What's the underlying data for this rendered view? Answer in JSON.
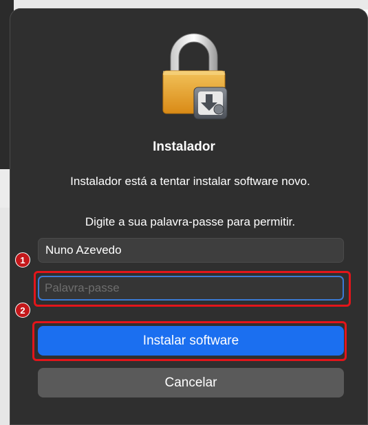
{
  "dialog": {
    "title": "Instalador",
    "message": "Instalador está a tentar instalar software novo.",
    "prompt": "Digite a sua palavra-passe para permitir.",
    "username_value": "Nuno Azevedo",
    "password_placeholder": "Palavra-passe",
    "install_label": "Instalar software",
    "cancel_label": "Cancelar",
    "icon": "lock-installer-icon"
  },
  "annotations": {
    "badge_1": "1",
    "badge_2": "2",
    "highlight_color": "#e3151a"
  },
  "colors": {
    "dialog_bg": "#2f2f2f",
    "accent": "#1b6ff0",
    "focus_ring": "#3a7bd5",
    "cancel_bg": "#5a5a5a"
  }
}
